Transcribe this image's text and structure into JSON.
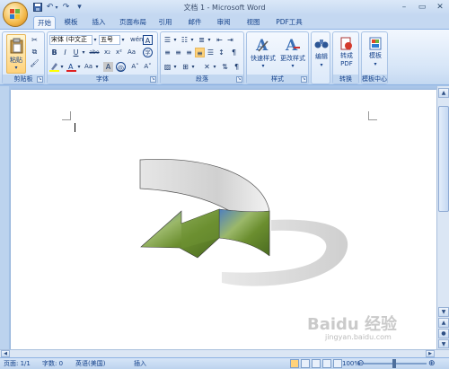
{
  "window": {
    "title": "文档 1 - Microsoft Word",
    "controls": {
      "minimize": "–",
      "maximize": "▭",
      "close": "✕"
    }
  },
  "quick_access": {
    "save_icon": "floppy-icon",
    "undo_glyph": "↶",
    "redo_glyph": "↷",
    "customize_glyph": "▾"
  },
  "tabs": [
    "开始",
    "插入",
    "页面布局",
    "引用",
    "邮件",
    "审阅",
    "视图",
    "PDF工具"
  ],
  "modified_tab": "模板",
  "ribbon": {
    "clipboard": {
      "paste_label": "粘贴",
      "group_label": "剪贴板"
    },
    "font": {
      "font_name": "宋体 (中文正",
      "font_size": "五号",
      "group_label": "字体",
      "bold": "B",
      "italic": "I",
      "underline": "U",
      "strike": "abe",
      "subscript": "x₂",
      "superscript": "x²",
      "case": "Aa",
      "phonetic": "wén",
      "grow": "A˄",
      "shrink": "A˅",
      "clear": "A",
      "char_border": "A",
      "char_shade": "A",
      "enclose": "字"
    },
    "paragraph": {
      "group_label": "段落"
    },
    "styles": {
      "quick_styles_label": "快速样式",
      "change_styles_label": "更改样式",
      "group_label": "样式"
    },
    "editing": {
      "label": "编辑"
    },
    "pdf": {
      "label_line1": "转成",
      "label_line2": "PDF",
      "group_label": "转换"
    },
    "template": {
      "label": "模板",
      "group_label": "模板中心"
    }
  },
  "status": {
    "page": "页面: 1/1",
    "words": "字数: 0",
    "language": "英语(美国)",
    "mode": "插入",
    "zoom": "100%"
  },
  "watermark": {
    "text": "Baidu 经验",
    "sub": "jingyan.baidu.com"
  },
  "colors": {
    "ribbon_bg": "#dce9f9",
    "accent": "#15428b",
    "arrow_face": "#d9d9d9",
    "arrow_shadow": "#d3d3d3",
    "grass_green": "#6b8e2f",
    "sky_blue": "#5aa0d8"
  }
}
